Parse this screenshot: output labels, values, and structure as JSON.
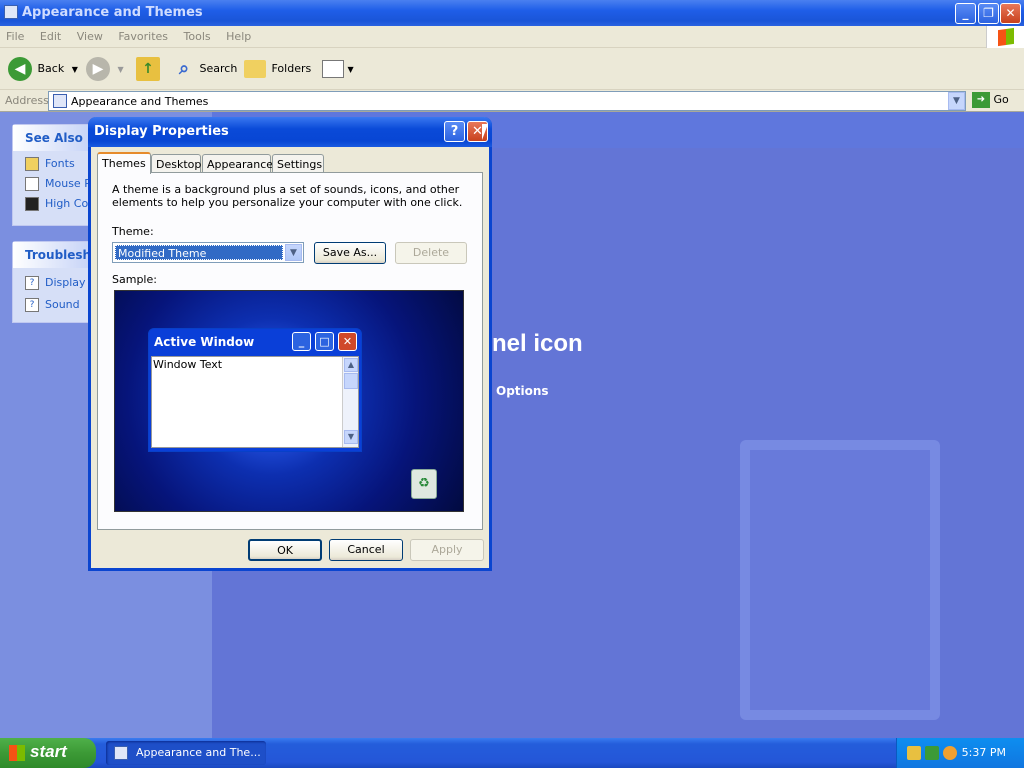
{
  "explorer": {
    "title": "Appearance and Themes",
    "menu": [
      "File",
      "Edit",
      "View",
      "Favorites",
      "Tools",
      "Help"
    ],
    "toolbar": {
      "back": "Back",
      "search": "Search",
      "folders": "Folders"
    },
    "address_label": "Address",
    "address_value": "Appearance and Themes",
    "go": "Go"
  },
  "left_panel": {
    "see_also": {
      "title": "See Also",
      "items": [
        "Fonts",
        "Mouse P",
        "High Con"
      ]
    },
    "troubleshooters": {
      "title": "Troublesho",
      "items": [
        "Display",
        "Sound"
      ]
    }
  },
  "main": {
    "heading_fragment": "nel icon",
    "link_fragment": "Options"
  },
  "dialog": {
    "title": "Display Properties",
    "tabs": [
      "Themes",
      "Desktop",
      "Appearance",
      "Settings"
    ],
    "selected_tab": "Themes",
    "description": "A theme is a background plus a set of sounds, icons, and other elements to help you personalize your computer with one click.",
    "theme_label": "Theme:",
    "theme_value": "Modified Theme",
    "save_as": "Save As...",
    "delete": "Delete",
    "sample_label": "Sample:",
    "sample_window": {
      "title": "Active Window",
      "text": "Window Text"
    },
    "ok": "OK",
    "cancel": "Cancel",
    "apply": "Apply"
  },
  "taskbar": {
    "start": "start",
    "task": "Appearance and The...",
    "clock": "5:37 PM"
  }
}
